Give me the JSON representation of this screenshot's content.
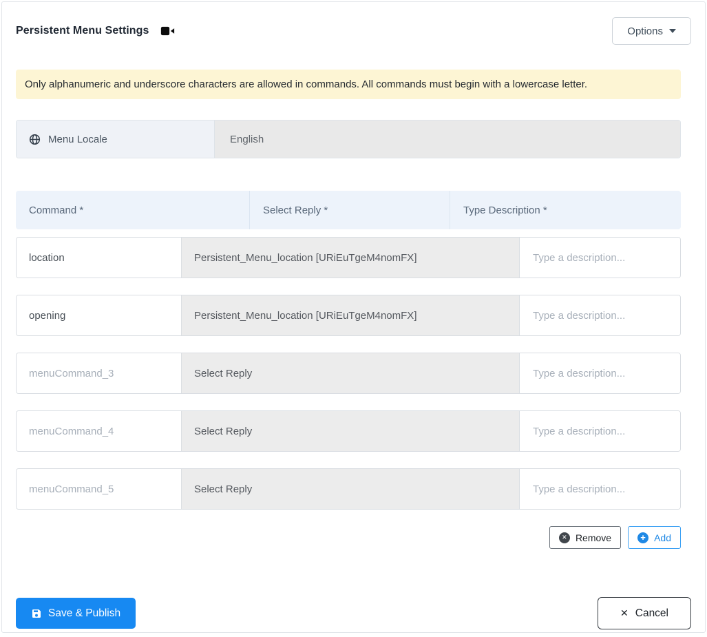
{
  "header": {
    "title": "Persistent Menu Settings",
    "options_label": "Options"
  },
  "alert": {
    "text": "Only alphanumeric and underscore characters are allowed in commands. All commands must begin with a lowercase letter."
  },
  "locale": {
    "label": "Menu Locale",
    "value": "English"
  },
  "table": {
    "headers": {
      "command": "Command *",
      "reply": "Select Reply *",
      "description": "Type Description *"
    },
    "rows": [
      {
        "command_value": "location",
        "command_placeholder": "",
        "command_is_placeholder": false,
        "reply": "Persistent_Menu_location [URiEuTgeM4nomFX]",
        "reply_is_placeholder": false,
        "description_value": "",
        "description_placeholder": "Type a description..."
      },
      {
        "command_value": "opening",
        "command_placeholder": "",
        "command_is_placeholder": false,
        "reply": "Persistent_Menu_location [URiEuTgeM4nomFX]",
        "reply_is_placeholder": false,
        "description_value": "",
        "description_placeholder": "Type a description..."
      },
      {
        "command_value": "",
        "command_placeholder": "menuCommand_3",
        "command_is_placeholder": true,
        "reply": "Select Reply",
        "reply_is_placeholder": true,
        "description_value": "",
        "description_placeholder": "Type a description..."
      },
      {
        "command_value": "",
        "command_placeholder": "menuCommand_4",
        "command_is_placeholder": true,
        "reply": "Select Reply",
        "reply_is_placeholder": true,
        "description_value": "",
        "description_placeholder": "Type a description..."
      },
      {
        "command_value": "",
        "command_placeholder": "menuCommand_5",
        "command_is_placeholder": true,
        "reply": "Select Reply",
        "reply_is_placeholder": true,
        "description_value": "",
        "description_placeholder": "Type a description..."
      }
    ],
    "remove_label": "Remove",
    "add_label": "Add"
  },
  "footer": {
    "save_label": "Save & Publish",
    "cancel_label": "Cancel"
  },
  "colors": {
    "accent_blue": "#1789f2",
    "link_blue": "#1e88e5",
    "alert_bg": "#fdf5d4",
    "table_header_bg": "#edf3fb",
    "select_cell_bg": "#ececec",
    "locale_label_bg": "#eff2f7",
    "locale_value_bg": "#e9e9e9"
  }
}
